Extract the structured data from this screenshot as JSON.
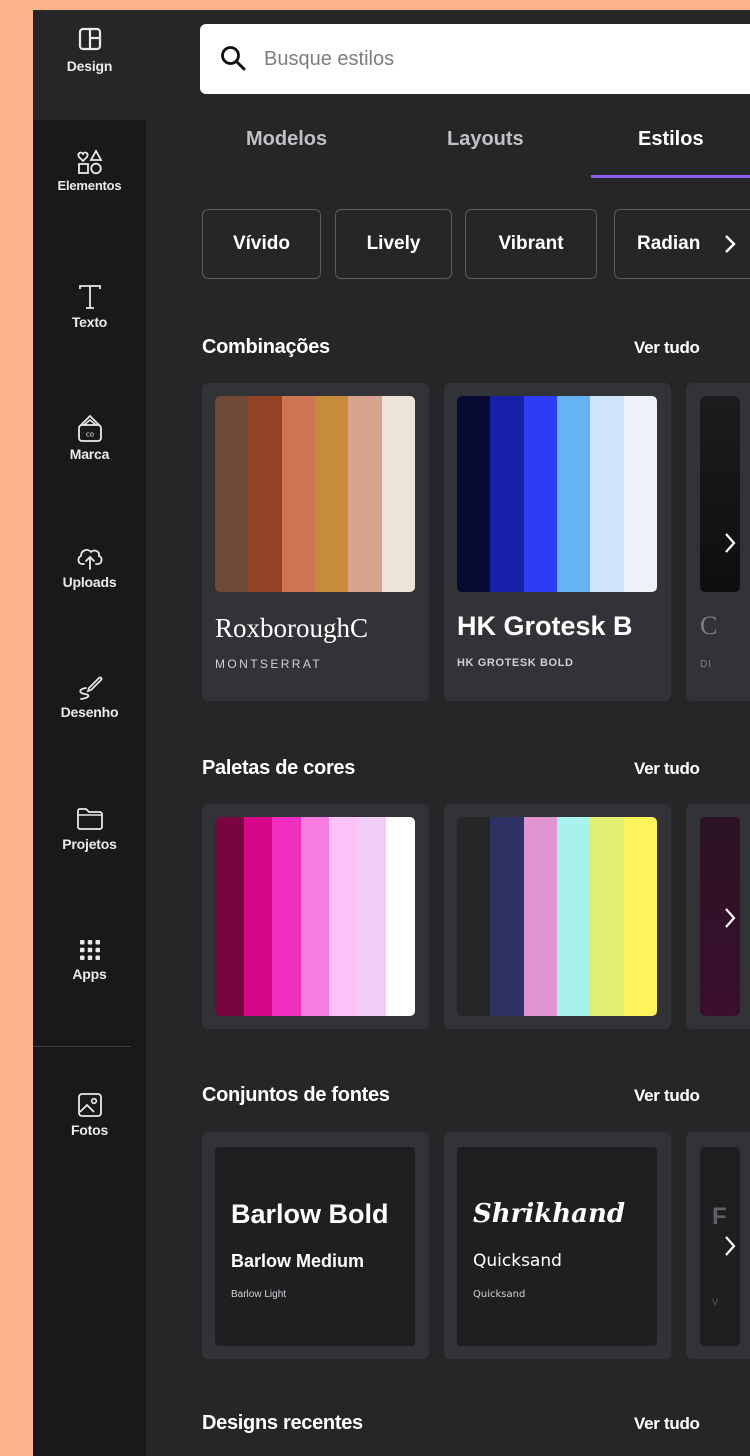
{
  "sidebar": {
    "items": [
      {
        "label": "Design",
        "icon": "layout-icon"
      },
      {
        "label": "Elementos",
        "icon": "shapes-icon"
      },
      {
        "label": "Texto",
        "icon": "text-icon"
      },
      {
        "label": "Marca",
        "icon": "brand-icon"
      },
      {
        "label": "Uploads",
        "icon": "cloud-upload-icon"
      },
      {
        "label": "Desenho",
        "icon": "draw-icon"
      },
      {
        "label": "Projetos",
        "icon": "folder-icon"
      },
      {
        "label": "Apps",
        "icon": "apps-grid-icon"
      },
      {
        "label": "Fotos",
        "icon": "image-icon"
      }
    ]
  },
  "search": {
    "placeholder": "Busque estilos",
    "value": ""
  },
  "tabs": [
    {
      "label": "Modelos",
      "active": false
    },
    {
      "label": "Layouts",
      "active": false
    },
    {
      "label": "Estilos",
      "active": true
    }
  ],
  "chips": [
    "Vívido",
    "Lively",
    "Vibrant",
    "Radian"
  ],
  "sections": {
    "combos": {
      "title": "Combinações",
      "see_all": "Ver tudo",
      "cards": [
        {
          "colors": [
            "#6e4935",
            "#924325",
            "#d07552",
            "#c78d3d",
            "#d6a38f",
            "#ede3d9"
          ],
          "heading_font": "RoxboroughC",
          "body_font": "MONTSERRAT"
        },
        {
          "colors": [
            "#070a33",
            "#1720a6",
            "#2f3cf5",
            "#66b3f3",
            "#cfe6fb",
            "#eef1f9"
          ],
          "heading_font": "HK Grotesk B",
          "body_font": "HK GROTESK BOLD"
        }
      ]
    },
    "palettes": {
      "title": "Paletas de cores",
      "see_all": "Ver tudo",
      "cards": [
        {
          "colors": [
            "#78053f",
            "#d6078a",
            "#f02ec0",
            "#f67ce0",
            "#fcc1f7",
            "#f0cdf6",
            "#ffffff"
          ]
        },
        {
          "colors": [
            "#262626",
            "#2e3264",
            "#e094d2",
            "#a8f1ec",
            "#dff070",
            "#fdf45c"
          ]
        }
      ]
    },
    "fontsets": {
      "title": "Conjuntos de fontes",
      "see_all": "Ver tudo",
      "cards": [
        {
          "line1": "Barlow Bold",
          "line2": "Barlow Medium",
          "line3": "Barlow Light"
        },
        {
          "line1": "Shrikhand",
          "line2": "Quicksand",
          "line3": "Quicksand"
        }
      ]
    },
    "recent": {
      "title": "Designs recentes",
      "see_all": "Ver tudo"
    }
  }
}
